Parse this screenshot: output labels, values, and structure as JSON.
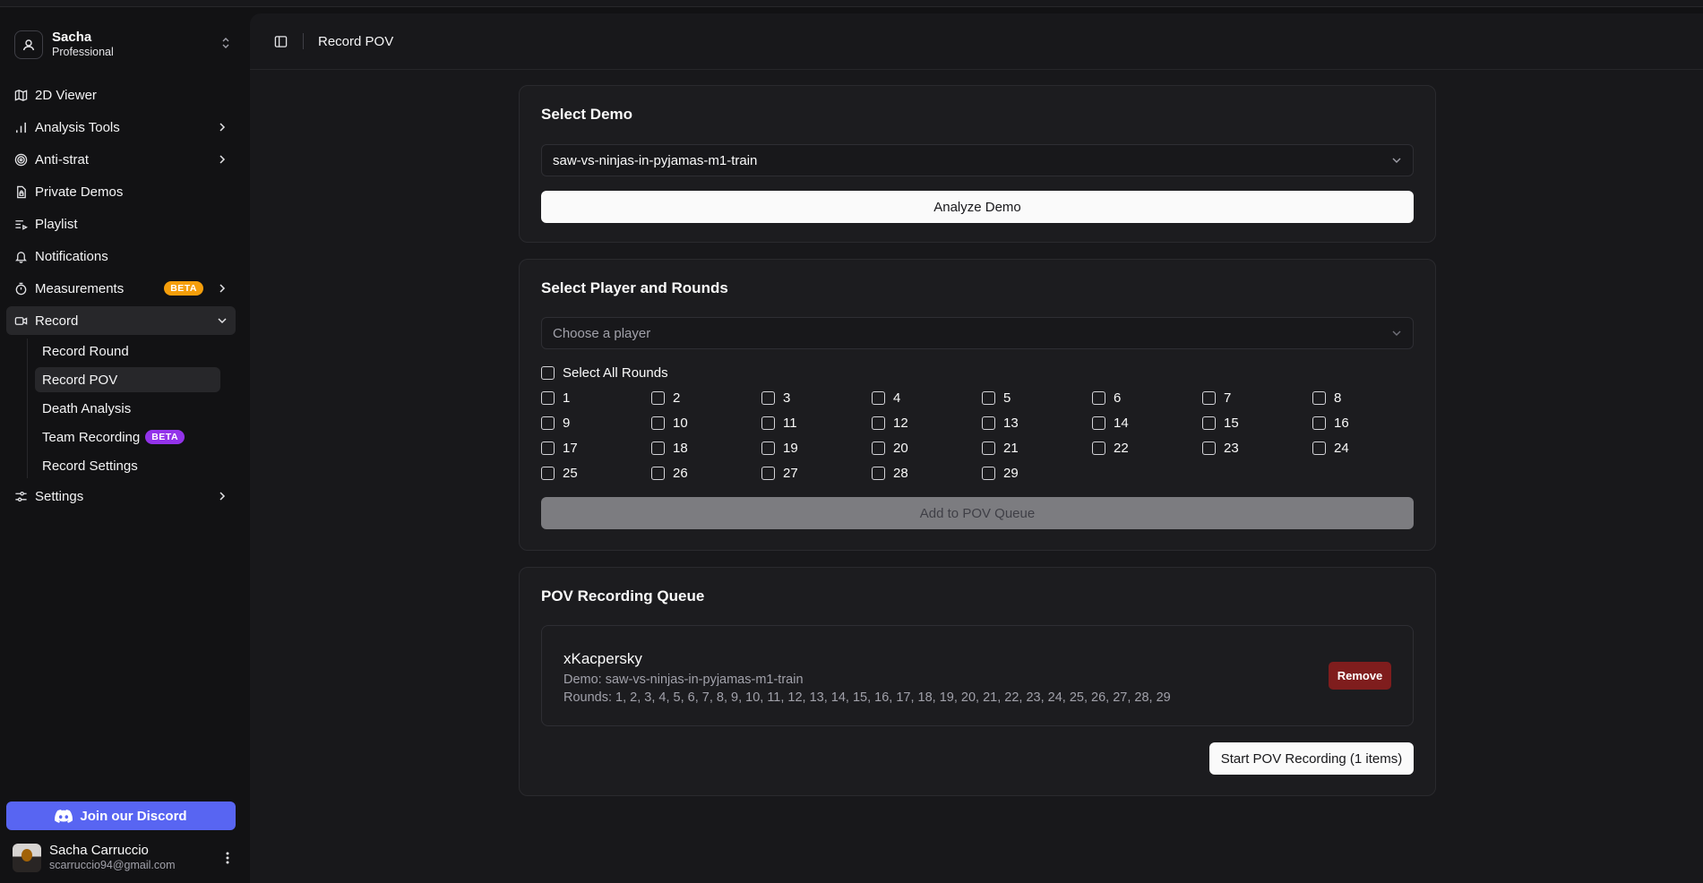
{
  "team": {
    "name": "Sacha",
    "plan": "Professional"
  },
  "nav": {
    "viewer": "2D Viewer",
    "analysis": "Analysis Tools",
    "antistrat": "Anti-strat",
    "private_demos": "Private Demos",
    "playlist": "Playlist",
    "notifications": "Notifications",
    "measurements": "Measurements",
    "measurements_badge": "BETA",
    "record": "Record",
    "record_sub": {
      "round": "Record Round",
      "pov": "Record POV",
      "death": "Death Analysis",
      "team": "Team Recording",
      "team_badge": "BETA",
      "settings": "Record Settings"
    },
    "settings": "Settings"
  },
  "discord": {
    "label": "Join our Discord",
    "color": "#5865f2"
  },
  "user": {
    "name": "Sacha Carruccio",
    "email": "scarruccio94@gmail.com"
  },
  "header": {
    "title": "Record POV"
  },
  "select_demo": {
    "title": "Select Demo",
    "selected": "saw-vs-ninjas-in-pyjamas-m1-train",
    "analyze_label": "Analyze Demo"
  },
  "select_player": {
    "title": "Select Player and Rounds",
    "placeholder": "Choose a player",
    "select_all_label": "Select All Rounds",
    "rounds": [
      "1",
      "2",
      "3",
      "4",
      "5",
      "6",
      "7",
      "8",
      "9",
      "10",
      "11",
      "12",
      "13",
      "14",
      "15",
      "16",
      "17",
      "18",
      "19",
      "20",
      "21",
      "22",
      "23",
      "24",
      "25",
      "26",
      "27",
      "28",
      "29"
    ],
    "add_label": "Add to POV Queue"
  },
  "queue": {
    "title": "POV Recording Queue",
    "items": [
      {
        "player": "xKacpersky",
        "demo": "Demo: saw-vs-ninjas-in-pyjamas-m1-train",
        "rounds": "Rounds: 1, 2, 3, 4, 5, 6, 7, 8, 9, 10, 11, 12, 13, 14, 15, 16, 17, 18, 19, 20, 21, 22, 23, 24, 25, 26, 27, 28, 29",
        "remove_label": "Remove"
      }
    ],
    "start_label": "Start POV Recording (1 items)"
  },
  "colors": {
    "beta_orange": "#f59e0b",
    "beta_purple": "#9333ea",
    "remove_red": "#7f1d1d"
  }
}
